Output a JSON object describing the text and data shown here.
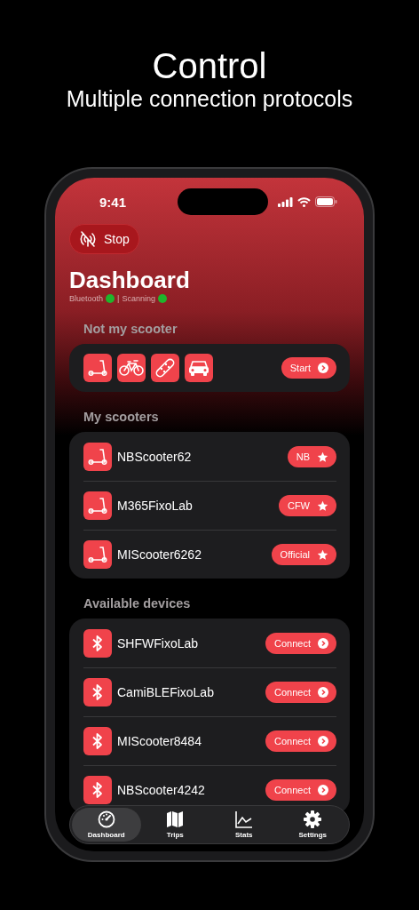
{
  "headline": {
    "title": "Control",
    "subtitle": "Multiple connection protocols"
  },
  "status_bar": {
    "time": "9:41"
  },
  "stop_button": {
    "label": "Stop"
  },
  "page_title": "Dashboard",
  "status": [
    {
      "label": "Bluetooth",
      "on": true
    },
    {
      "label": "Scanning",
      "on": true
    }
  ],
  "status_separator": "|",
  "quick_section": {
    "title": "Not my scooter",
    "types": [
      {
        "kind": "scooter"
      },
      {
        "kind": "bike"
      },
      {
        "kind": "skateboard"
      },
      {
        "kind": "car"
      }
    ],
    "button": "Start"
  },
  "my_scooters": {
    "title": "My scooters",
    "items": [
      {
        "name": "NBScooter62",
        "badge": "NB",
        "favorite": true
      },
      {
        "name": "M365FixoLab",
        "badge": "CFW",
        "favorite": true
      },
      {
        "name": "MIScooter6262",
        "badge": "Official",
        "favorite": true
      }
    ]
  },
  "available_devices": {
    "title": "Available devices",
    "items": [
      {
        "name": "SHFWFixoLab",
        "button": "Connect"
      },
      {
        "name": "CamiBLEFixoLab",
        "button": "Connect"
      },
      {
        "name": "MIScooter8484",
        "button": "Connect"
      },
      {
        "name": "NBScooter4242",
        "button": "Connect"
      }
    ]
  },
  "tabs": [
    {
      "label": "Dashboard",
      "kind": "dashboard",
      "selected": true
    },
    {
      "label": "Trips",
      "kind": "trips",
      "selected": false
    },
    {
      "label": "Stats",
      "kind": "stats",
      "selected": false
    },
    {
      "label": "Settings",
      "kind": "settings",
      "selected": false
    }
  ]
}
